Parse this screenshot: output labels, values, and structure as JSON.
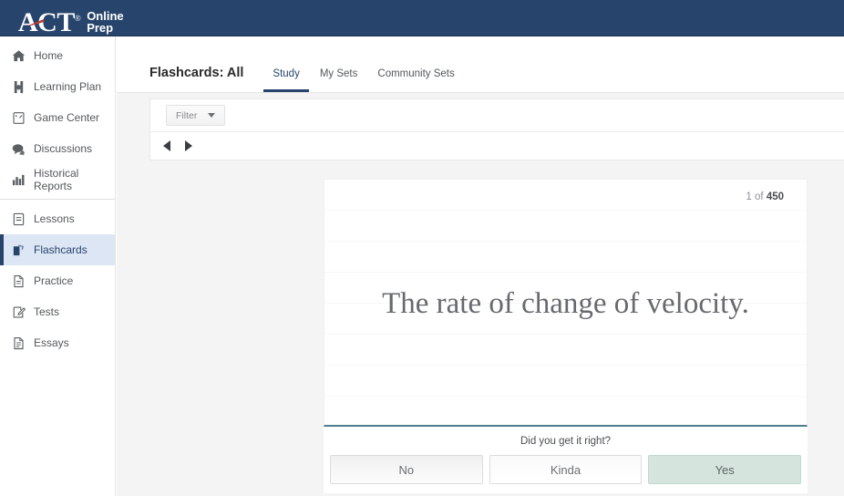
{
  "brand": {
    "name": "ACT",
    "registered": "®",
    "sub_line1": "Online",
    "sub_line2": "Prep",
    "header_color": "#27456c",
    "swoosh_color": "#c0392b"
  },
  "sidebar": {
    "groups": [
      {
        "items": [
          {
            "label": "Home",
            "icon": "home-icon",
            "active": false
          },
          {
            "label": "Learning Plan",
            "icon": "learning-plan-icon",
            "active": false
          },
          {
            "label": "Game Center",
            "icon": "game-center-icon",
            "active": false
          },
          {
            "label": "Discussions",
            "icon": "discussions-icon",
            "active": false
          },
          {
            "label": "Historical Reports",
            "icon": "bar-chart-icon",
            "active": false
          }
        ]
      },
      {
        "items": [
          {
            "label": "Lessons",
            "icon": "lessons-icon",
            "active": false
          },
          {
            "label": "Flashcards",
            "icon": "flashcards-icon",
            "active": true
          },
          {
            "label": "Practice",
            "icon": "practice-icon",
            "active": false
          },
          {
            "label": "Tests",
            "icon": "tests-icon",
            "active": false
          },
          {
            "label": "Essays",
            "icon": "essays-icon",
            "active": false
          }
        ]
      }
    ],
    "active_color": "#dce6f4",
    "active_accent": "#27456c"
  },
  "page": {
    "title": "Flashcards: All",
    "tabs": [
      {
        "label": "Study",
        "active": true
      },
      {
        "label": "My Sets",
        "active": false
      },
      {
        "label": "Community Sets",
        "active": false
      }
    ]
  },
  "toolbar": {
    "filter_label": "Filter",
    "filter_icon": "chevron-down-icon",
    "prev_icon": "triangle-left-icon",
    "next_icon": "triangle-right-icon"
  },
  "flashcard": {
    "counter_prefix": "1 of ",
    "counter_total": "450",
    "text": "The rate of change of velocity.",
    "prompt": "Did you get it right?",
    "buttons": [
      {
        "label": "No",
        "state": "default"
      },
      {
        "label": "Kinda",
        "state": "default"
      },
      {
        "label": "Yes",
        "state": "highlighted"
      }
    ],
    "highlight_color": "#d5e5de",
    "bottom_rule_color": "#4e7d8e"
  }
}
